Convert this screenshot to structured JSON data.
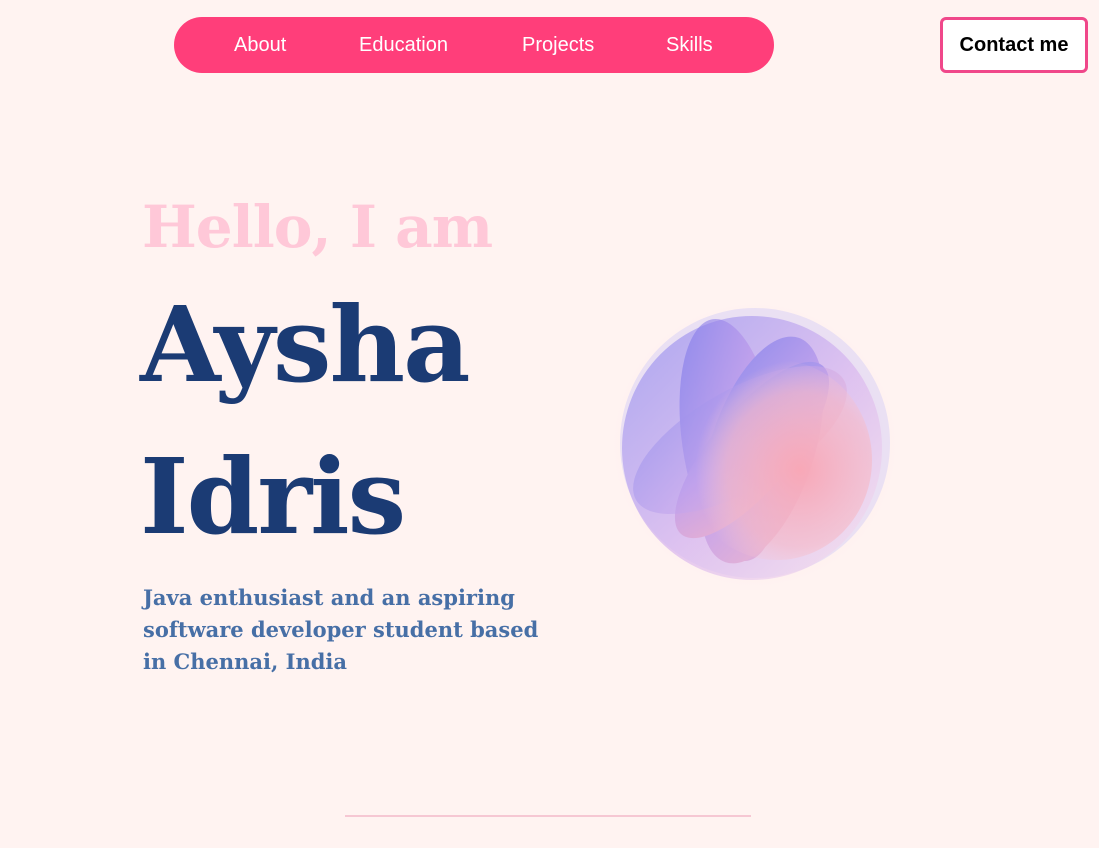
{
  "nav": {
    "items": [
      {
        "label": "About"
      },
      {
        "label": "Education"
      },
      {
        "label": "Projects"
      },
      {
        "label": "Skills"
      }
    ],
    "contact_label": "Contact me"
  },
  "hero": {
    "greeting": "Hello, I am",
    "first_name": "Aysha",
    "last_name": "Idris",
    "tagline": "Java enthusiast and an aspiring software developer student based in Chennai, India"
  },
  "colors": {
    "background": "#fff3f1",
    "nav_accent": "#ff3e7a",
    "contact_border": "#f0478a",
    "greeting": "#ffc8d8",
    "name": "#1b3b74",
    "tagline": "#476fa6"
  },
  "decor": {
    "orb": "gradient-orb-graphic"
  }
}
